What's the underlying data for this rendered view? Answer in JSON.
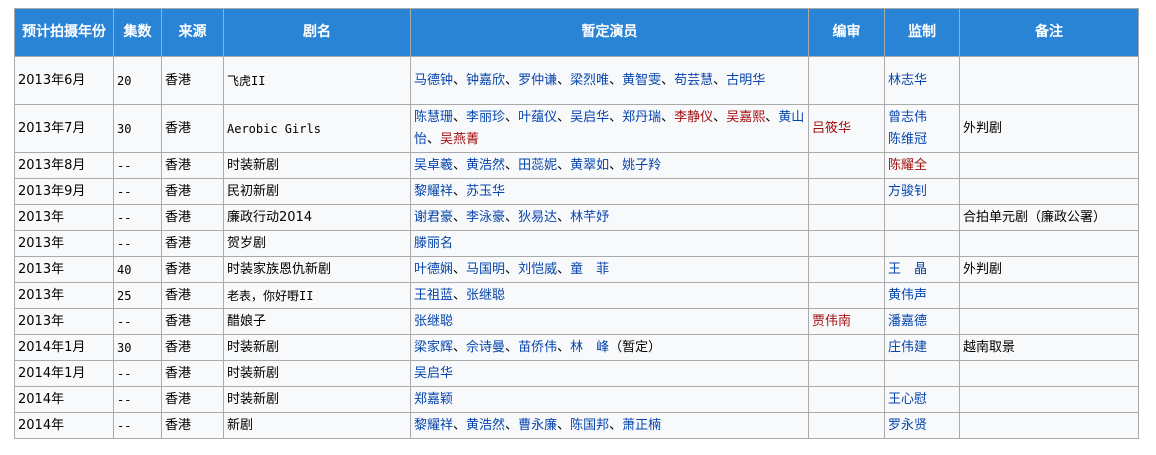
{
  "headers": [
    "预计拍摄年份",
    "集数",
    "来源",
    "剧名",
    "暂定演员",
    "编审",
    "监制",
    "备注"
  ],
  "rows": [
    {
      "date": "2013年6月",
      "episodes": "20",
      "source": "香港",
      "title": "飞虎II",
      "cast": [
        {
          "name": "马德钟",
          "red": false
        },
        {
          "name": "钟嘉欣",
          "red": false
        },
        {
          "name": "罗仲谦",
          "red": false
        },
        {
          "name": "梁烈唯",
          "red": false
        },
        {
          "name": "黄智雯",
          "red": false
        },
        {
          "name": "苟芸慧",
          "red": false
        },
        {
          "name": "古明华",
          "red": false
        }
      ],
      "editor": [],
      "producer": [
        {
          "name": "林志华",
          "red": false
        }
      ],
      "note": ""
    },
    {
      "date": "2013年7月",
      "episodes": "30",
      "source": "香港",
      "title": "Aerobic Girls",
      "cast": [
        {
          "name": "陈慧珊",
          "red": false
        },
        {
          "name": "李丽珍",
          "red": false
        },
        {
          "name": "叶蕴仪",
          "red": false
        },
        {
          "name": "吴启华",
          "red": false
        },
        {
          "name": "郑丹瑞",
          "red": false
        },
        {
          "name": "李静仪",
          "red": true
        },
        {
          "name": "吴嘉熙",
          "red": true
        },
        {
          "name": "黄山怡",
          "red": false
        },
        {
          "name": "吴燕菁",
          "red": true
        }
      ],
      "editor": [
        {
          "name": "吕筱华",
          "red": true
        }
      ],
      "producer": [
        {
          "name": "曾志伟",
          "red": false
        },
        {
          "name": "陈维冠",
          "red": false
        }
      ],
      "note": "外判剧"
    },
    {
      "date": "2013年8月",
      "episodes": "--",
      "source": "香港",
      "title": "时装新剧",
      "cast": [
        {
          "name": "吴卓羲",
          "red": false
        },
        {
          "name": "黄浩然",
          "red": false
        },
        {
          "name": "田蕊妮",
          "red": false
        },
        {
          "name": "黄翠如",
          "red": false
        },
        {
          "name": "姚子羚",
          "red": false
        }
      ],
      "editor": [],
      "producer": [
        {
          "name": "陈耀全",
          "red": true
        }
      ],
      "note": ""
    },
    {
      "date": "2013年9月",
      "episodes": "--",
      "source": "香港",
      "title": "民初新剧",
      "cast": [
        {
          "name": "黎耀祥",
          "red": false
        },
        {
          "name": "苏玉华",
          "red": false
        }
      ],
      "editor": [],
      "producer": [
        {
          "name": "方骏钊",
          "red": false
        }
      ],
      "note": ""
    },
    {
      "date": "2013年",
      "episodes": "--",
      "source": "香港",
      "title": "廉政行动2014",
      "cast": [
        {
          "name": "谢君豪",
          "red": false
        },
        {
          "name": "李泳豪",
          "red": false
        },
        {
          "name": "狄易达",
          "red": false
        },
        {
          "name": "林芊妤",
          "red": false
        }
      ],
      "editor": [],
      "producer": [],
      "note": "合拍单元剧（廉政公署）"
    },
    {
      "date": "2013年",
      "episodes": "--",
      "source": "香港",
      "title": "贺岁剧",
      "cast": [
        {
          "name": "滕丽名",
          "red": false
        }
      ],
      "editor": [],
      "producer": [],
      "note": ""
    },
    {
      "date": "2013年",
      "episodes": "40",
      "source": "香港",
      "title": "时装家族恩仇新剧",
      "cast": [
        {
          "name": "叶德娴",
          "red": false
        },
        {
          "name": "马国明",
          "red": false
        },
        {
          "name": "刘恺威",
          "red": false
        },
        {
          "name": "童　菲",
          "red": false
        }
      ],
      "editor": [],
      "producer": [
        {
          "name": "王　晶",
          "red": false
        }
      ],
      "note": "外判剧"
    },
    {
      "date": "2013年",
      "episodes": "25",
      "source": "香港",
      "title": "老表，你好嘢II",
      "cast": [
        {
          "name": "王祖蓝",
          "red": false
        },
        {
          "name": "张继聪",
          "red": false
        }
      ],
      "editor": [],
      "producer": [
        {
          "name": "黄伟声",
          "red": false
        }
      ],
      "note": ""
    },
    {
      "date": "2013年",
      "episodes": "--",
      "source": "香港",
      "title": "醋娘子",
      "cast": [
        {
          "name": "张继聪",
          "red": false
        }
      ],
      "editor": [
        {
          "name": "贾伟南",
          "red": true
        }
      ],
      "producer": [
        {
          "name": "潘嘉德",
          "red": false
        }
      ],
      "note": ""
    },
    {
      "date": "2014年1月",
      "episodes": "30",
      "source": "香港",
      "title": "时装新剧",
      "cast": [
        {
          "name": "梁家辉",
          "red": false
        },
        {
          "name": "佘诗曼",
          "red": false
        },
        {
          "name": "苗侨伟",
          "red": false
        },
        {
          "name": "林　峰",
          "red": false
        }
      ],
      "cast_suffix": "（暂定）",
      "editor": [],
      "producer": [
        {
          "name": "庄伟建",
          "red": false
        }
      ],
      "note": "越南取景"
    },
    {
      "date": "2014年1月",
      "episodes": "--",
      "source": "香港",
      "title": "时装新剧",
      "cast": [
        {
          "name": "吴启华",
          "red": false
        }
      ],
      "editor": [],
      "producer": [],
      "note": ""
    },
    {
      "date": "2014年",
      "episodes": "--",
      "source": "香港",
      "title": "时装新剧",
      "cast": [
        {
          "name": "郑嘉颖",
          "red": false
        }
      ],
      "editor": [],
      "producer": [
        {
          "name": "王心慰",
          "red": false
        }
      ],
      "note": ""
    },
    {
      "date": "2014年",
      "episodes": "--",
      "source": "香港",
      "title": "新剧",
      "cast": [
        {
          "name": "黎耀祥",
          "red": false
        },
        {
          "name": "黄浩然",
          "red": false
        },
        {
          "name": "曹永廉",
          "red": false
        },
        {
          "name": "陈国邦",
          "red": false
        },
        {
          "name": "萧正楠",
          "red": false
        }
      ],
      "editor": [],
      "producer": [
        {
          "name": "罗永贤",
          "red": false
        }
      ],
      "note": ""
    }
  ]
}
